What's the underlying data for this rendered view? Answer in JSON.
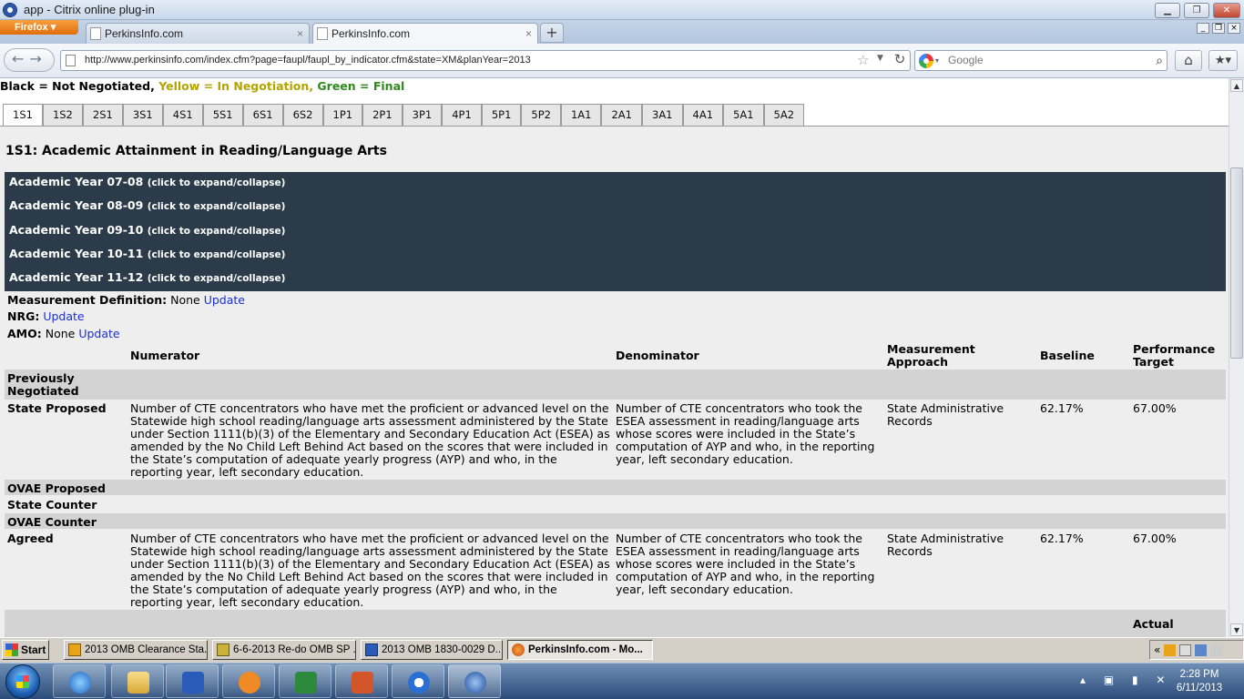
{
  "window": {
    "title": "app - Citrix online plug-in"
  },
  "browser": {
    "menu_button": "Firefox",
    "tabs": [
      {
        "label": "PerkinsInfo.com"
      },
      {
        "label": "PerkinsInfo.com"
      }
    ],
    "new_tab": "+",
    "url": "http://www.perkinsinfo.com/index.cfm?page=faupl/faupl_by_indicator.cfm&state=XM&planYear=2013",
    "search_placeholder": "Google"
  },
  "legend": {
    "black": "Black = Not Negotiated,",
    "yellow": "Yellow = In Negotiation,",
    "green": "Green = Final"
  },
  "indicator_tabs": [
    "1S1",
    "1S2",
    "2S1",
    "3S1",
    "4S1",
    "5S1",
    "6S1",
    "6S2",
    "1P1",
    "2P1",
    "3P1",
    "4P1",
    "5P1",
    "5P2",
    "1A1",
    "2A1",
    "3A1",
    "4A1",
    "5A1",
    "5A2"
  ],
  "heading": "1S1: Academic Attainment in Reading/Language Arts",
  "years": [
    {
      "label": "Academic Year 07-08",
      "hint": "(click to expand/collapse)"
    },
    {
      "label": "Academic Year 08-09",
      "hint": "(click to expand/collapse)"
    },
    {
      "label": "Academic Year 09-10",
      "hint": "(click to expand/collapse)"
    },
    {
      "label": "Academic Year 10-11",
      "hint": "(click to expand/collapse)"
    },
    {
      "label": "Academic Year 11-12",
      "hint": "(click to expand/collapse)"
    }
  ],
  "definitions": {
    "measurement_label": "Measurement Definition:",
    "measurement_value": "None",
    "nrg_label": "NRG:",
    "amo_label": "AMO:",
    "amo_value": "None",
    "update": "Update"
  },
  "columns": {
    "numerator": "Numerator",
    "denominator": "Denominator",
    "approach": "Measurement Approach",
    "baseline": "Baseline",
    "target": "Performance Target",
    "actual": "Actual"
  },
  "rows": {
    "previously_negotiated": "Previously Negotiated",
    "state_proposed": {
      "label": "State Proposed",
      "numerator": "Number of CTE concentrators who have met the proficient or advanced level on the Statewide high school reading/language arts assessment administered by the State under Section 1111(b)(3) of the Elementary and Secondary Education Act (ESEA) as amended by the No Child Left Behind Act based on the scores that were included in the State’s computation of adequate yearly progress (AYP) and who, in the reporting year, left secondary education.",
      "denominator": "Number of CTE concentrators who took the ESEA assessment in reading/language arts whose scores were included in the State’s computation of AYP and who, in the reporting year, left secondary education.",
      "approach": "State Administrative Records",
      "baseline": "62.17%",
      "target": "67.00%"
    },
    "ovae_proposed": "OVAE Proposed",
    "state_counter": "State Counter",
    "ovae_counter": "OVAE Counter",
    "agreed": {
      "label": "Agreed",
      "numerator": "Number of CTE concentrators who have met the proficient or advanced level on the Statewide high school reading/language arts assessment administered by the State under Section 1111(b)(3) of the Elementary and Secondary Education Act (ESEA) as amended by the No Child Left Behind Act based on the scores that were included in the State’s computation of adequate yearly progress (AYP) and who, in the reporting year, left secondary education.",
      "denominator": "Number of CTE concentrators who took the ESEA assessment in reading/language arts whose scores were included in the State’s computation of AYP and who, in the reporting year, left secondary education.",
      "approach": "State Administrative Records",
      "baseline": "62.17%",
      "target": "67.00%"
    }
  },
  "citrix_taskbar": {
    "start": "Start",
    "items": [
      {
        "label": "2013 OMB Clearance Sta...",
        "icon": "outlook-icon"
      },
      {
        "label": "6-6-2013 Re-do OMB SP ...",
        "icon": "edit-icon"
      },
      {
        "label": "2013 OMB 1830-0029 D...",
        "icon": "word-icon"
      },
      {
        "label": "PerkinsInfo.com - Mo...",
        "icon": "firefox-icon"
      }
    ],
    "tray_chevron": "«"
  },
  "clock": {
    "time": "2:28 PM",
    "date": "6/11/2013"
  },
  "colors": {
    "year_block": "#2c3b4a",
    "link": "#1b2fd6",
    "yellow": "#b3a400",
    "green": "#2f8a1e"
  }
}
